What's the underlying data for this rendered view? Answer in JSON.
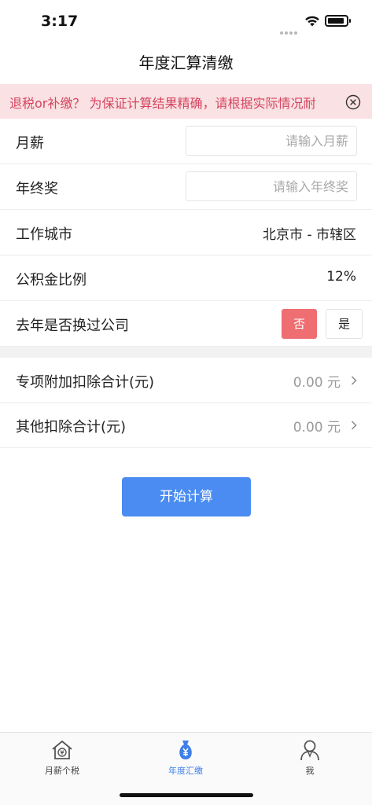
{
  "status": {
    "time": "3:17"
  },
  "nav": {
    "title": "年度汇算清缴"
  },
  "notice": {
    "text": "退税or补缴？   为保证计算结果精确，请根据实际情况耐"
  },
  "form": {
    "monthly_salary": {
      "label": "月薪",
      "placeholder": "请输入月薪"
    },
    "annual_bonus": {
      "label": "年终奖",
      "placeholder": "请输入年终奖"
    },
    "work_city": {
      "label": "工作城市",
      "value": "北京市 - 市辖区"
    },
    "housing_fund_ratio": {
      "label": "公积金比例",
      "value": "12%"
    },
    "changed_company": {
      "label": "去年是否换过公司",
      "no_label": "否",
      "yes_label": "是",
      "selected": "否"
    },
    "special_deductions": {
      "label": "专项附加扣除合计(元)",
      "value": "0.00 元"
    },
    "other_deductions": {
      "label": "其他扣除合计(元)",
      "value": "0.00 元"
    }
  },
  "actions": {
    "calculate_label": "开始计算"
  },
  "tabbar": {
    "accent": "#3f7fe8",
    "items": [
      {
        "label": "月薪个税",
        "icon": "house-yen-icon",
        "active": false
      },
      {
        "label": "年度汇缴",
        "icon": "money-bag-yen-icon",
        "active": true
      },
      {
        "label": "我",
        "icon": "person-icon",
        "active": false
      }
    ]
  }
}
